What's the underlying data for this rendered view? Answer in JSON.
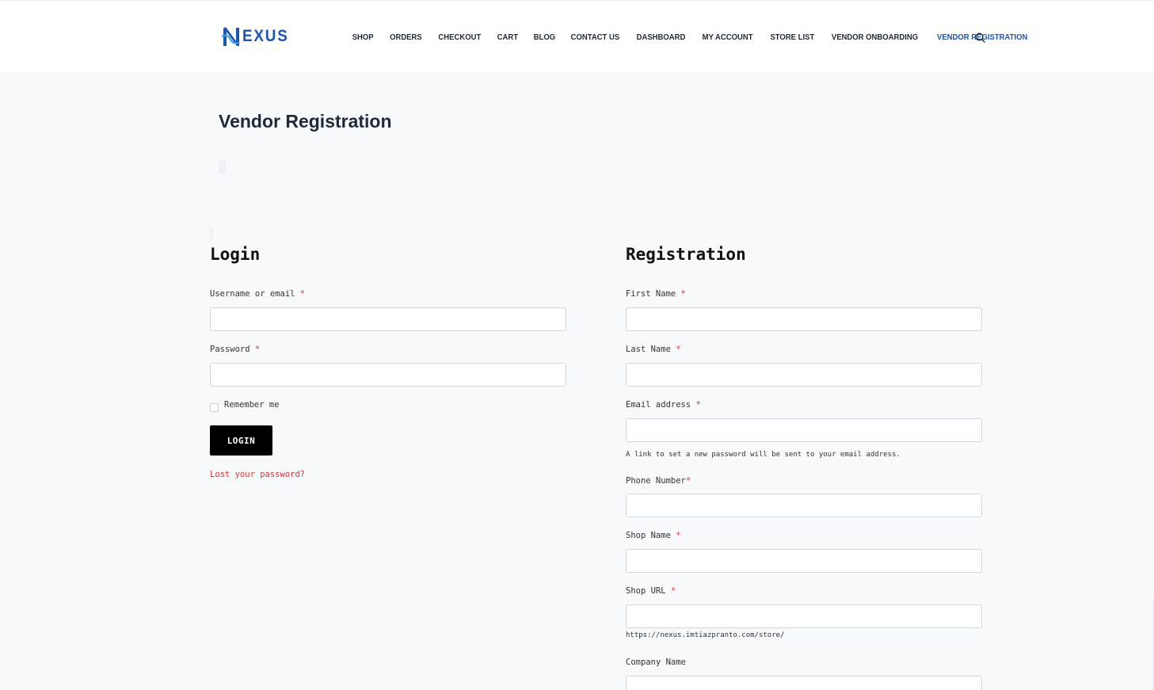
{
  "header": {
    "logo_text": "EXUS",
    "logo_letter": "N",
    "brand_color": "#1a56b8",
    "nav": [
      {
        "label": "SHOP"
      },
      {
        "label": "ORDERS"
      },
      {
        "label": "CHECKOUT"
      },
      {
        "label": "CART"
      },
      {
        "label": "BLOG"
      },
      {
        "label": "CONTACT US"
      },
      {
        "label": "DASHBOARD"
      },
      {
        "label": "MY ACCOUNT"
      },
      {
        "label": "STORE LIST"
      },
      {
        "label": "VENDOR ONBOARDING"
      },
      {
        "label": "VENDOR REGISTRATION",
        "active": true
      }
    ],
    "search_icon": "search-icon"
  },
  "page": {
    "title": "Vendor Registration"
  },
  "login": {
    "title": "Login",
    "username_label": "Username or email",
    "username_value": "",
    "password_label": "Password",
    "password_value": "",
    "remember_label": "Remember me",
    "remember_checked": false,
    "button_label": "LOGIN",
    "lost_password": "Lost your password?"
  },
  "registration": {
    "title": "Registration",
    "first_name_label": "First Name",
    "last_name_label": "Last Name",
    "email_label": "Email address",
    "email_hint": "A link to set a new password will be sent to your email address.",
    "phone_label": "Phone Number",
    "shop_name_label": "Shop Name",
    "shop_url_label": "Shop URL",
    "shop_url_hint": "https://nexus.imtiazpranto.com/store/",
    "company_label": "Company Name",
    "required_mark": "*"
  },
  "colors": {
    "accent": "#1a56b8",
    "required": "#d63638",
    "button_bg": "#000000",
    "page_bg": "#f8f9fb"
  }
}
